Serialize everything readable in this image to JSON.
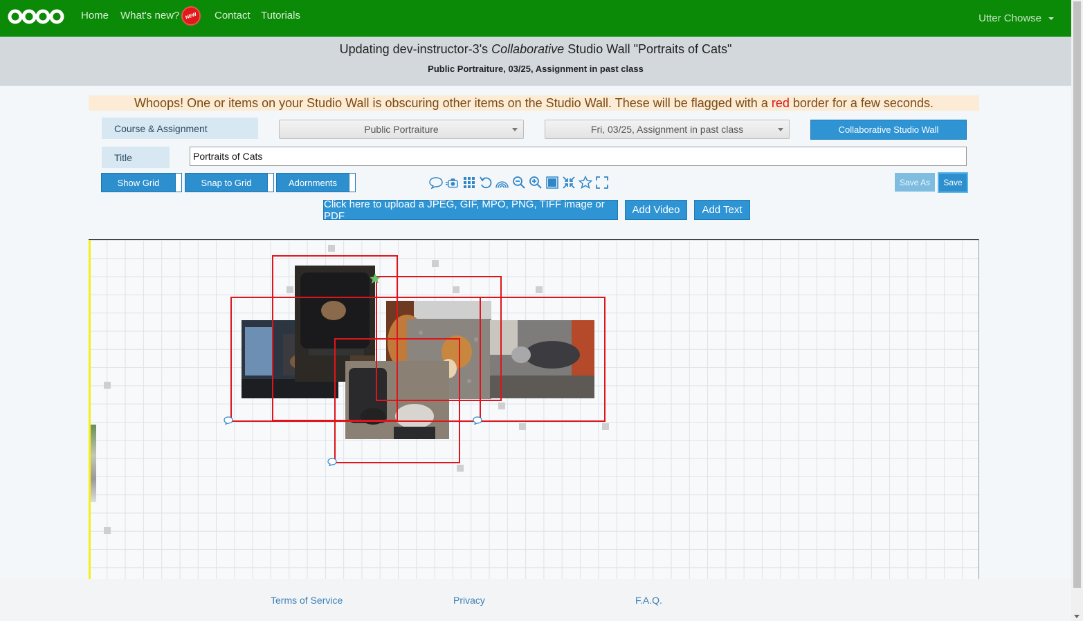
{
  "nav": {
    "logo": "oooo-logo",
    "links": [
      "Home",
      "What's new?",
      "Contact",
      "Tutorials"
    ],
    "new_badge": "NEW",
    "user": "Utter Chowse"
  },
  "header": {
    "title_prefix": "Updating dev-instructor-3's ",
    "title_italic": "Collaborative",
    "title_suffix": " Studio Wall \"Portraits of Cats\"",
    "subtitle": "Public Portraiture, 03/25, Assignment in past class"
  },
  "warning": {
    "before": "Whoops! One or items on your Studio Wall is obscuring other items on the Studio Wall. These will be flagged with a ",
    "red_word": "red",
    "after": " border for a few seconds."
  },
  "form": {
    "course_label": "Course & Assignment",
    "course_value": "Public Portraiture",
    "assignment_value": "Fri, 03/25, Assignment in past class",
    "wall_type_button": "Collaborative Studio Wall",
    "title_label": "Title",
    "title_value": "Portraits of Cats"
  },
  "toolbar": {
    "show_grid": "Show Grid",
    "snap_to_grid": "Snap to Grid",
    "adornments": "Adornments",
    "icons": [
      "comment-icon",
      "camera-move-icon",
      "grid-arrange-icon",
      "undo-icon",
      "rainbow-icon",
      "zoom-out-icon",
      "zoom-in-icon",
      "square-fill-icon",
      "collapse-icon",
      "star-icon",
      "fullscreen-icon"
    ],
    "save_as": "Save As",
    "save": "Save"
  },
  "actions": {
    "upload": "Click here to upload a JPEG, GIF, MPO, PNG, TIFF image or PDF",
    "add_video": "Add Video",
    "add_text": "Add Text"
  },
  "footer": {
    "terms": "Terms of Service",
    "privacy": "Privacy",
    "faq": "F.A.Q."
  },
  "colors": {
    "nav_green": "#0b8a07",
    "accent_blue": "#2e94d4",
    "flag_red": "#e0141c",
    "canvas_marker_yellow": "#f4ef14"
  }
}
